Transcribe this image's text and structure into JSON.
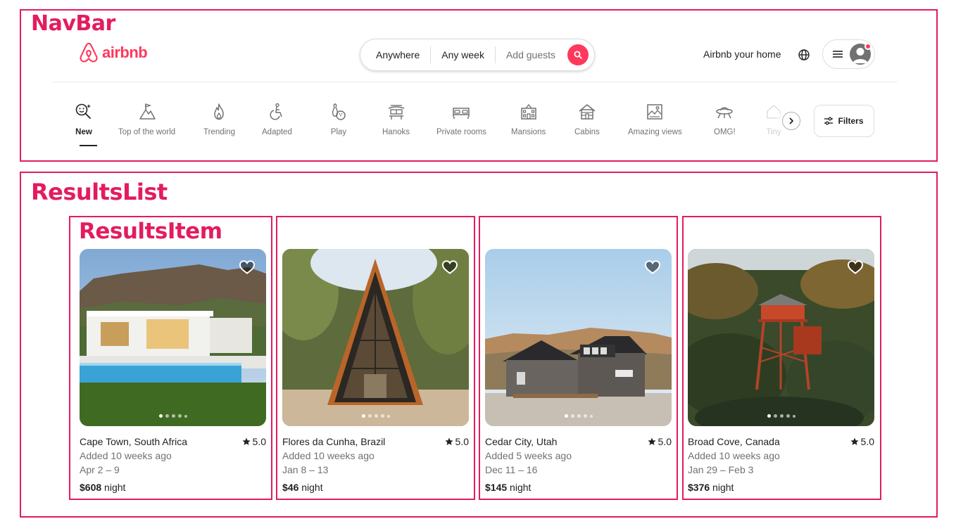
{
  "annotations": {
    "navbar": "NavBar",
    "results_list": "ResultsList",
    "results_item": "ResultsItem"
  },
  "brand": {
    "name": "airbnb",
    "color": "#ff385c"
  },
  "search": {
    "where": "Anywhere",
    "when": "Any week",
    "who": "Add guests"
  },
  "header": {
    "host_link": "Airbnb your home"
  },
  "categories": [
    {
      "label": "New",
      "icon": "new-icon",
      "active": true
    },
    {
      "label": "Top of the world",
      "icon": "top-of-world-icon"
    },
    {
      "label": "Trending",
      "icon": "flame-icon"
    },
    {
      "label": "Adapted",
      "icon": "wheelchair-icon"
    },
    {
      "label": "Play",
      "icon": "bowling-icon"
    },
    {
      "label": "Hanoks",
      "icon": "hanok-icon"
    },
    {
      "label": "Private rooms",
      "icon": "bed-icon"
    },
    {
      "label": "Mansions",
      "icon": "mansion-icon"
    },
    {
      "label": "Cabins",
      "icon": "cabin-icon"
    },
    {
      "label": "Amazing views",
      "icon": "view-icon"
    },
    {
      "label": "OMG!",
      "icon": "ufo-icon"
    },
    {
      "label": "Tiny",
      "icon": "tiny-home-icon"
    }
  ],
  "filters": {
    "label": "Filters"
  },
  "listings": [
    {
      "location": "Cape Town, South Africa",
      "rating": "5.0",
      "added": "Added 10 weeks ago",
      "dates": "Apr 2 – 9",
      "price": "$608",
      "unit": "night"
    },
    {
      "location": "Flores da Cunha, Brazil",
      "rating": "5.0",
      "added": "Added 10 weeks ago",
      "dates": "Jan 8 – 13",
      "price": "$46",
      "unit": "night"
    },
    {
      "location": "Cedar City, Utah",
      "rating": "5.0",
      "added": "Added 5 weeks ago",
      "dates": "Dec 11 – 16",
      "price": "$145",
      "unit": "night"
    },
    {
      "location": "Broad Cove, Canada",
      "rating": "5.0",
      "added": "Added 10 weeks ago",
      "dates": "Jan 29 – Feb 3",
      "price": "$376",
      "unit": "night"
    }
  ]
}
